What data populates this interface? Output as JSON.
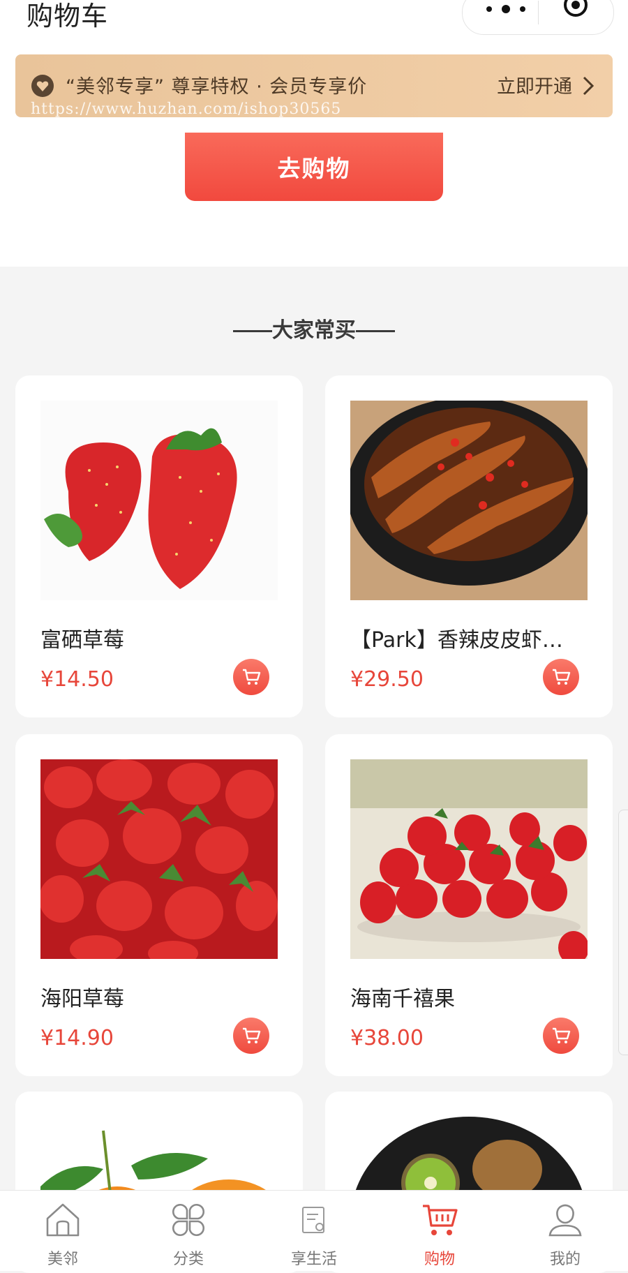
{
  "header": {
    "title": "购物车",
    "member_bar": {
      "text": "“美邻专享” 尊享特权 · 会员专享价",
      "cta": "立即开通"
    },
    "watermark": "https://www.huzhan.com/ishop30565"
  },
  "go_shopping_label": "去购物",
  "recommend_title": "大家常买",
  "products": [
    {
      "name": "富硒草莓",
      "price": "¥14.50",
      "image": "strawberry-pair"
    },
    {
      "name": "【Park】香辣皮皮虾…",
      "price": "¥29.50",
      "image": "spicy-mantis-shrimp"
    },
    {
      "name": "海阳草莓",
      "price": "¥14.90",
      "image": "strawberry-pile"
    },
    {
      "name": "海南千禧果",
      "price": "¥38.00",
      "image": "cherry-tomatoes"
    },
    {
      "name": "",
      "price": "",
      "image": "tangerines"
    },
    {
      "name": "",
      "price": "",
      "image": "kiwifruit"
    }
  ],
  "tabbar": [
    {
      "label": "美邻",
      "icon": "home-icon",
      "active": false
    },
    {
      "label": "分类",
      "icon": "category-icon",
      "active": false
    },
    {
      "label": "享生活",
      "icon": "life-icon",
      "active": false
    },
    {
      "label": "购物",
      "icon": "cart-icon",
      "active": true
    },
    {
      "label": "我的",
      "icon": "profile-icon",
      "active": false
    }
  ],
  "colors": {
    "accent": "#e7463a",
    "member_gold": "#efcba3",
    "price_red": "#e7463a"
  }
}
